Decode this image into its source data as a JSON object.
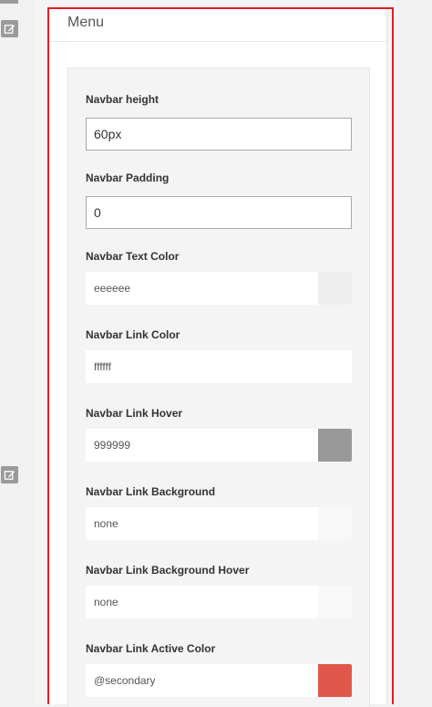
{
  "panel": {
    "title": "Menu"
  },
  "fields": [
    {
      "label": "Navbar height",
      "type": "text",
      "value": "60px"
    },
    {
      "label": "Navbar Padding",
      "type": "text",
      "value": "0"
    },
    {
      "label": "Navbar Text Color",
      "type": "color",
      "value": "eeeeee",
      "swatch": "#eeeeee"
    },
    {
      "label": "Navbar Link Color",
      "type": "color",
      "value": "ffffff",
      "swatch": "#ffffff"
    },
    {
      "label": "Navbar Link Hover",
      "type": "color",
      "value": "999999",
      "swatch": "#999999"
    },
    {
      "label": "Navbar Link Background",
      "type": "color",
      "value": "none",
      "swatch": "#f8f8f8"
    },
    {
      "label": "Navbar Link Background Hover",
      "type": "color",
      "value": "none",
      "swatch": "#f8f8f8"
    },
    {
      "label": "Navbar Link Active Color",
      "type": "color",
      "value": "@secondary",
      "swatch": "#e2574c"
    }
  ],
  "colors": {
    "highlight_frame": "#e31e24",
    "edit_icon": "#9a9a9a"
  },
  "icons": {
    "edit": "edit-icon"
  }
}
